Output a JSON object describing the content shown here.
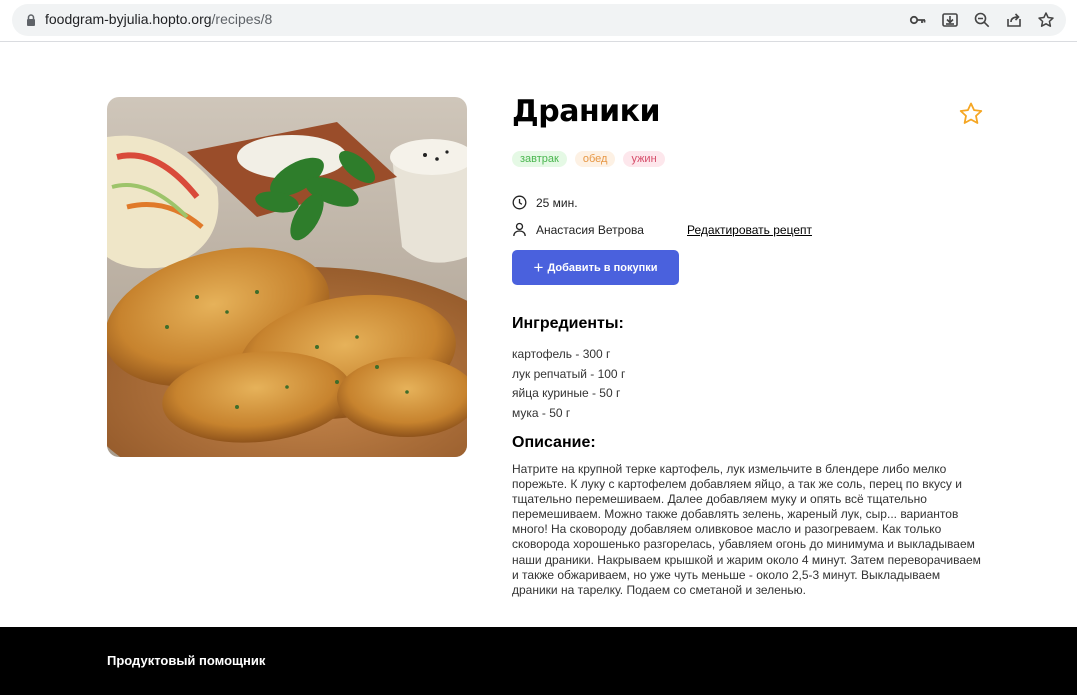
{
  "browser": {
    "url_host": "foodgram-byjulia.hopto.org",
    "url_path": "/recipes/8",
    "toolbar_icons": [
      "key-icon",
      "install-icon",
      "zoom-icon",
      "share-icon",
      "bookmark-star-icon"
    ]
  },
  "recipe": {
    "title": "Драники",
    "tags": [
      {
        "label": "завтрак",
        "color": "#49b64e"
      },
      {
        "label": "обед",
        "color": "#e79744"
      },
      {
        "label": "ужин",
        "color": "#d64d6a"
      }
    ],
    "cooking_time": "25 мин.",
    "author": "Анастасия Ветрова",
    "edit_link": "Редактировать рецепт",
    "add_to_cart_label": "Добавить в покупки",
    "ingredients_heading": "Ингредиенты:",
    "ingredients": [
      "картофель - 300 г",
      "лук репчатый - 100 г",
      "яйца куриные - 50 г",
      "мука - 50 г"
    ],
    "description_heading": "Описание:",
    "description": "Натрите на крупной терке картофель, лук измельчите в блендере либо мелко порежьте. К луку с картофелем добавляем яйцо, а так же соль, перец по вкусу и тщательно перемешиваем. Далее добавляем муку и опять всё тщательно перемешиваем. Можно также добавлять зелень, жареный лук, сыр... вариантов много! На сковороду добавляем оливковое масло и разогреваем. Как только сковорода хорошенько разгорелась, убавляем огонь до минимума и выкладываем наши драники. Накрываем крышкой и жарим около 4 минут. Затем переворачиваем и также обжариваем, но уже чуть меньше - около 2,5-3 минут. Выкладываем драники на тарелку. Подаем со сметаной и зеленью."
  },
  "footer": {
    "label": "Продуктовый помощник"
  },
  "colors": {
    "accent": "#4a61dd",
    "favorite_star": "#f5a623",
    "footer_bg": "#000000"
  }
}
